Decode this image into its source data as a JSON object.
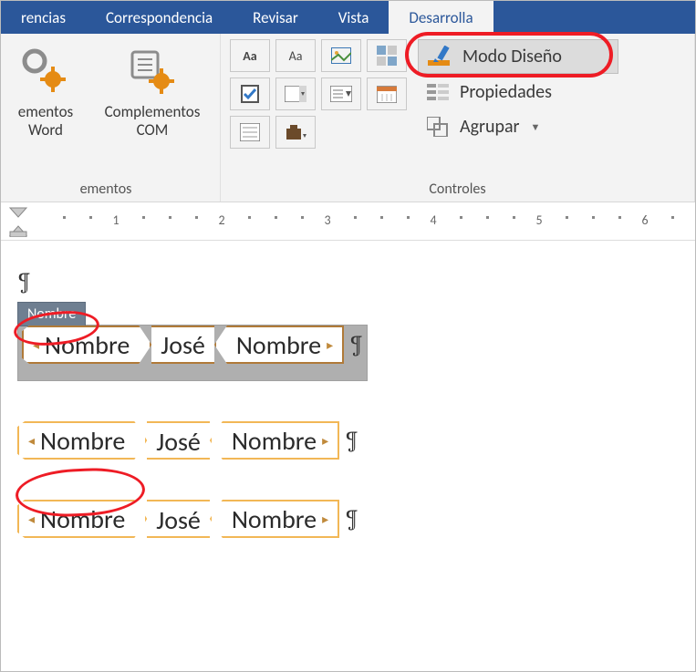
{
  "tabs": {
    "t0": "rencias",
    "t1": "Correspondencia",
    "t2": "Revisar",
    "t3": "Vista",
    "t4": "Desarrolla"
  },
  "ribbon": {
    "word_addins": "ementos\nWord",
    "com_addins": "Complementos\nCOM",
    "group_addins_label": "ementos",
    "group_controls_label": "Controles",
    "design_mode": "Modo Diseño",
    "properties": "Propiedades",
    "group": "Agrupar",
    "aa_rich": "Aa",
    "aa_plain": "Aa"
  },
  "ruler": {
    "nums": [
      "1",
      "2",
      "3",
      "4",
      "5",
      "6"
    ]
  },
  "doc": {
    "control_title_tab": "Nombre",
    "tag_open": "Nombre",
    "value": "José",
    "tag_close": "Nombre",
    "pilcrow": "¶"
  }
}
